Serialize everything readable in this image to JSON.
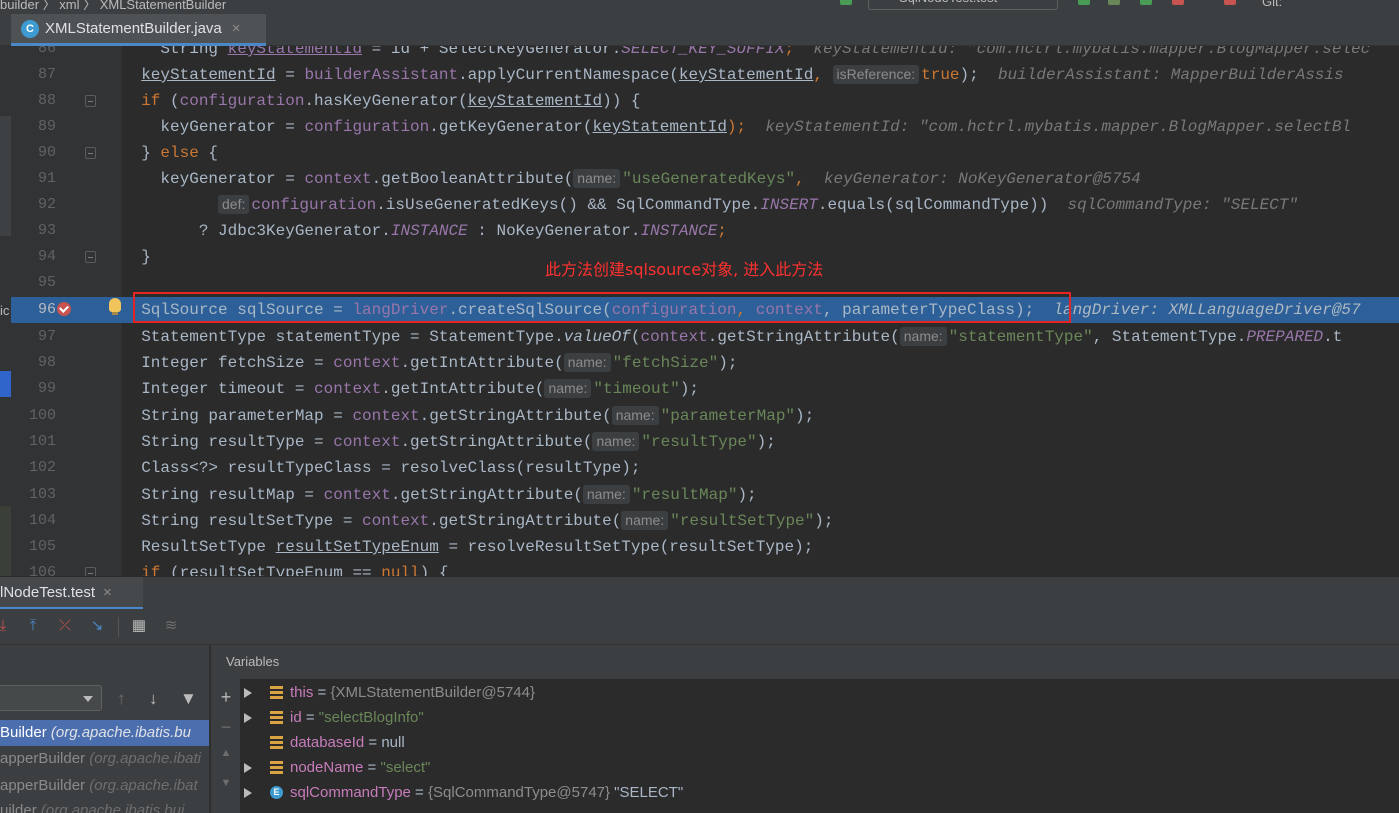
{
  "topbar": {
    "breadcrumb": "builder  〉  xml  〉  XMLStatementBuilder",
    "run_config": "SqlNodeTest.test",
    "right_clip": "Git:"
  },
  "tab": {
    "label": "XMLStatementBuilder.java",
    "icon": "class-icon",
    "close": "×"
  },
  "editor": {
    "annotation": "此方法创建sqlsource对象, 进入此方法",
    "left_clip": "ic",
    "line_numbers": [
      "86",
      "87",
      "88",
      "89",
      "90",
      "91",
      "92",
      "93",
      "94",
      "95",
      "96",
      "97",
      "98",
      "99",
      "100",
      "101",
      "102",
      "103",
      "104",
      "105",
      "106"
    ],
    "lines": {
      "l86a": "String ",
      "l86b": "keyStatementId",
      "l86c": " = id + SelectKeyGenerator.",
      "l86d": "SELECT_KEY_SUFFIX",
      "l86e": ";  ",
      "l86f": "keyStatementId: \"com.hctrl.mybatis.mapper.BlogMapper.selec",
      "l87a": "keyStatementId",
      "l87b": " = ",
      "l87c": "builderAssistant",
      "l87d": ".applyCurrentNamespace(",
      "l87e": "keyStatementId",
      "l87f": ", ",
      "l87hint": "isReference:",
      "l87g": "true",
      "l87h": ");  ",
      "l87i": "builderAssistant: MapperBuilderAssis",
      "l88a": "if",
      "l88b": " (",
      "l88c": "configuration",
      "l88d": ".hasKeyGenerator(",
      "l88e": "keyStatementId",
      "l88f": ")) {",
      "l89a": "keyGenerator",
      "l89b": " = ",
      "l89c": "configuration",
      "l89d": ".getKeyGenerator(",
      "l89e": "keyStatementId",
      "l89f": ");  ",
      "l89g": "keyStatementId: \"com.hctrl.mybatis.mapper.BlogMapper.selectBl",
      "l90a": "} ",
      "l90b": "else",
      "l90c": " {",
      "l91a": "keyGenerator",
      "l91b": " = ",
      "l91c": "context",
      "l91d": ".getBooleanAttribute(",
      "l91hint": "name:",
      "l91e": "\"useGeneratedKeys\"",
      "l91f": ",  ",
      "l91g": "keyGenerator: NoKeyGenerator@5754",
      "l92hint": "def:",
      "l92a": "configuration",
      "l92b": ".isUseGeneratedKeys() && SqlCommandType.",
      "l92c": "INSERT",
      "l92d": ".equals(sqlCommandType))  ",
      "l92e": "sqlCommandType: \"SELECT\"",
      "l93a": "? Jdbc3KeyGenerator.",
      "l93b": "INSTANCE",
      "l93c": " : NoKeyGenerator.",
      "l93d": "INSTANCE",
      "l93e": ";",
      "l94a": "}",
      "l96a": "SqlSource sqlSource = ",
      "l96b": "langDriver",
      "l96c": ".createSqlSource(",
      "l96d": "configuration",
      "l96e": ", ",
      "l96f": "context",
      "l96g": ", parameterTypeClass);  ",
      "l96h": "langDriver: XMLLanguageDriver@57",
      "l97a": "StatementType statementType = StatementType.",
      "l97b": "valueOf",
      "l97c": "(",
      "l97d": "context",
      "l97e": ".getStringAttribute(",
      "l97hint": "name:",
      "l97f": "\"statementType\"",
      "l97g": ", StatementType.",
      "l97h": "PREPARED",
      "l97i": ".t",
      "l98a": "Integer fetchSize = ",
      "l98b": "context",
      "l98c": ".getIntAttribute(",
      "l98hint": "name:",
      "l98d": "\"fetchSize\"",
      "l98e": ");",
      "l99a": "Integer timeout = ",
      "l99b": "context",
      "l99c": ".getIntAttribute(",
      "l99hint": "name:",
      "l99d": "\"timeout\"",
      "l99e": ");",
      "l100a": "String parameterMap = ",
      "l100b": "context",
      "l100c": ".getStringAttribute(",
      "l100hint": "name:",
      "l100d": "\"parameterMap\"",
      "l100e": ");",
      "l101a": "String resultType = ",
      "l101b": "context",
      "l101c": ".getStringAttribute(",
      "l101hint": "name:",
      "l101d": "\"resultType\"",
      "l101e": ");",
      "l102a": "Class<?> resultTypeClass = resolveClass(resultType);",
      "l103a": "String resultMap = ",
      "l103b": "context",
      "l103c": ".getStringAttribute(",
      "l103hint": "name:",
      "l103d": "\"resultMap\"",
      "l103e": ");",
      "l104a": "String resultSetType = ",
      "l104b": "context",
      "l104c": ".getStringAttribute(",
      "l104hint": "name:",
      "l104d": "\"resultSetType\"",
      "l104e": ");",
      "l105a": "ResultSetType ",
      "l105b": "resultSetTypeEnum",
      "l105c": " = resolveResultSetType(resultSetType);",
      "l106a": "if",
      "l106b": " (",
      "l106c": "resultSetTypeEnum",
      "l106d": " == ",
      "l106e": "null",
      "l106f": ") {"
    }
  },
  "debug": {
    "tab_label": "lNodeTest.test",
    "tab_close": "×",
    "variables_title": "Variables",
    "frames": [
      {
        "method": "Builder ",
        "pkg": "(org.apache.ibatis.bu"
      },
      {
        "method": "apperBuilder ",
        "pkg": "(org.apache.ibati"
      },
      {
        "method": "apperBuilder ",
        "pkg": "(org.apache.ibat"
      },
      {
        "method": "uilder ",
        "pkg": "(org.apache.ibatis.bui"
      }
    ],
    "variables": [
      {
        "name": "this",
        "eq": " = ",
        "value": "{XMLStatementBuilder@5744}",
        "extra": ""
      },
      {
        "name": "id",
        "eq": " = ",
        "value": "\"selectBlogInfo\"",
        "extra": ""
      },
      {
        "name": "databaseId",
        "eq": " = ",
        "value": "null",
        "extra": ""
      },
      {
        "name": "nodeName",
        "eq": " = ",
        "value": "\"select\"",
        "extra": ""
      },
      {
        "name": "sqlCommandType",
        "eq": " = ",
        "value": "{SqlCommandType@5747}",
        "extra": " \"SELECT\""
      }
    ]
  },
  "colors": {
    "accent": "#4a88c7",
    "exec_line": "#2d6099",
    "highlight_box": "#e52424",
    "annotation": "#ff3030"
  }
}
